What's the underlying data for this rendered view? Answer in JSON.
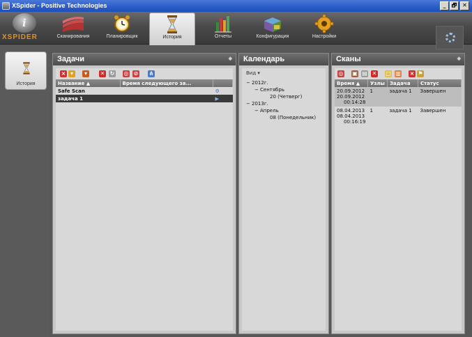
{
  "window": {
    "title": "XSpider - Positive Technologies",
    "buttons": [
      "_",
      "🗗",
      "✕"
    ]
  },
  "logo": {
    "text": "XSPIDER",
    "glyph": "i"
  },
  "nav": [
    {
      "label": "Сканирования",
      "icon": "scans-icon"
    },
    {
      "label": "Планировщик",
      "icon": "alarm-clock-icon"
    },
    {
      "label": "История",
      "icon": "hourglass-icon",
      "active": true
    },
    {
      "label": "Отчеты",
      "icon": "reports-chart-icon"
    },
    {
      "label": "Конфигурация",
      "icon": "configuration-blocks-icon"
    },
    {
      "label": "Настройки",
      "icon": "settings-gear-icon"
    }
  ],
  "sidebar": {
    "history_label": "История"
  },
  "tasks": {
    "title": "Задачи",
    "columns": [
      "Название ▲",
      "Время следующего за..."
    ],
    "rows": [
      {
        "name": "Safe Scan",
        "bold": true,
        "selected": false
      },
      {
        "name": "задача 1",
        "bold": true,
        "selected": true
      }
    ]
  },
  "calendar": {
    "title": "Календарь",
    "view_label": "Вид ▾",
    "tree": [
      {
        "level": 0,
        "toggle": "−",
        "text": "2012г."
      },
      {
        "level": 1,
        "toggle": "−",
        "text": "Сентябрь"
      },
      {
        "level": 2,
        "toggle": "",
        "text": "20 (Четверг)"
      },
      {
        "level": 0,
        "toggle": "−",
        "text": "2013г."
      },
      {
        "level": 1,
        "toggle": "−",
        "text": "Апрель"
      },
      {
        "level": 2,
        "toggle": "",
        "text": "08 (Понедельник)"
      }
    ]
  },
  "scans": {
    "title": "Сканы",
    "columns": [
      "Время ▲",
      "Узлы",
      "Задача",
      "Статус"
    ],
    "rows": [
      {
        "time": [
          "20.09.2012",
          "20.09.2012",
          "00:14:28"
        ],
        "nodes": "1",
        "task": "задача 1",
        "status": "Завершен",
        "selected": true
      },
      {
        "time": [
          "08.04.2013",
          "08.04.2013",
          "00:16:19"
        ],
        "nodes": "1",
        "task": "задача 1",
        "status": "Завершен",
        "selected": false
      }
    ]
  },
  "colors": {
    "accent": "#e8911c",
    "titlebar": "#2a5bc8",
    "selected_row": "#3a3a3a"
  }
}
